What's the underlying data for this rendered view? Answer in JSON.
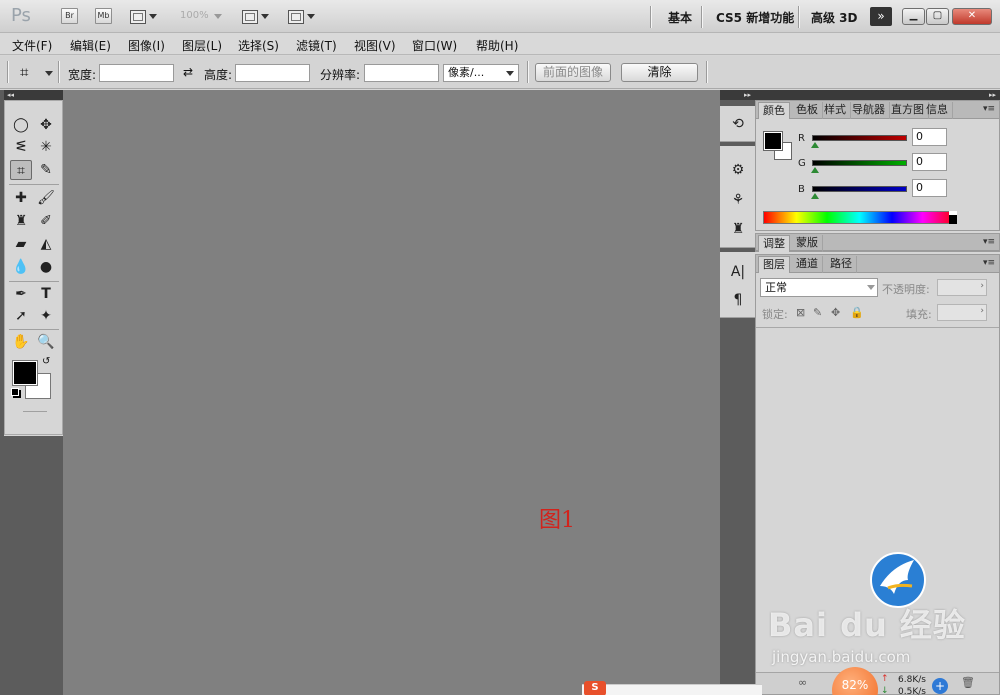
{
  "app": {
    "logo": "Ps",
    "bridge_label": "Br",
    "minibridge_label": "Mb",
    "zoom": "100%",
    "workspaces": [
      "基本",
      "CS5 新增功能",
      "高级 3D"
    ],
    "more_label": "»"
  },
  "menu": [
    "文件(F)",
    "编辑(E)",
    "图像(I)",
    "图层(L)",
    "选择(S)",
    "滤镜(T)",
    "视图(V)",
    "窗口(W)",
    "帮助(H)"
  ],
  "options": {
    "width_label": "宽度:",
    "height_label": "高度:",
    "resolution_label": "分辨率:",
    "unit_select": "像素/...",
    "front_image_button": "前面的图像",
    "clear_button": "清除"
  },
  "canvas": {
    "caption": "图1",
    "background": "#808080"
  },
  "color_panel": {
    "tabs": [
      "颜色",
      "色板",
      "样式",
      "导航器",
      "直方图",
      "信息"
    ],
    "channels": [
      {
        "name": "R",
        "value": "0",
        "color": "#c00000"
      },
      {
        "name": "G",
        "value": "0",
        "color": "#009a00"
      },
      {
        "name": "B",
        "value": "0",
        "color": "#0000c0"
      }
    ],
    "foreground": "#000000",
    "background": "#ffffff"
  },
  "adjust_panel": {
    "tabs": [
      "调整",
      "蒙版"
    ]
  },
  "layers_panel": {
    "tabs": [
      "图层",
      "通道",
      "路径"
    ],
    "blend_mode": "正常",
    "opacity_label": "不透明度:",
    "lock_label": "锁定:",
    "fill_label": "填充:"
  },
  "watermark": {
    "brand": "Bai du 经验",
    "url": "jingyan.baidu.com"
  },
  "tray": {
    "net_percent": "82%",
    "upload": "6.8K/s",
    "download": "0.5K/s",
    "ime": "S"
  }
}
